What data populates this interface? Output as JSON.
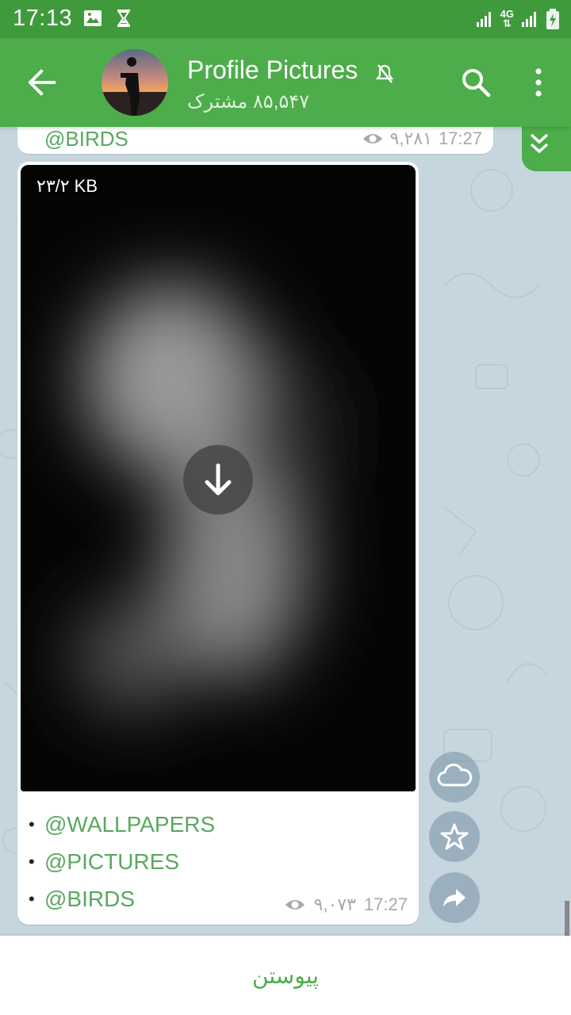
{
  "status_bar": {
    "time": "17:13",
    "network_label": "4G",
    "icons": [
      "image-icon",
      "hourglass-icon",
      "signal-icon",
      "network-4g-icon",
      "signal-icon",
      "battery-charging-icon"
    ]
  },
  "header": {
    "title": "Profile Pictures",
    "subtitle": "۸۵,۵۴۷ مشترک",
    "icons": [
      "back-arrow-icon",
      "mute-icon",
      "search-icon",
      "more-vert-icon"
    ]
  },
  "previous_message": {
    "link": "@BIRDS",
    "views": "۹,۲۸۱",
    "time": "17:27"
  },
  "message": {
    "file_size": "۲۳/۲ KB",
    "caption": [
      "@WALLPAPERS",
      "@PICTURES",
      "@BIRDS"
    ],
    "views": "۹,۰۷۳",
    "time": "17:27"
  },
  "side_actions": [
    "cloud-icon",
    "star-icon",
    "share-arrow-icon"
  ],
  "bottom_bar": {
    "join_label": "پیوستن"
  },
  "colors": {
    "status_bar": "#3f9a3c",
    "header": "#4cad4a",
    "link": "#5aa85e",
    "chat_bg": "#c6d6df",
    "meta_gray": "#a4a9ad"
  }
}
